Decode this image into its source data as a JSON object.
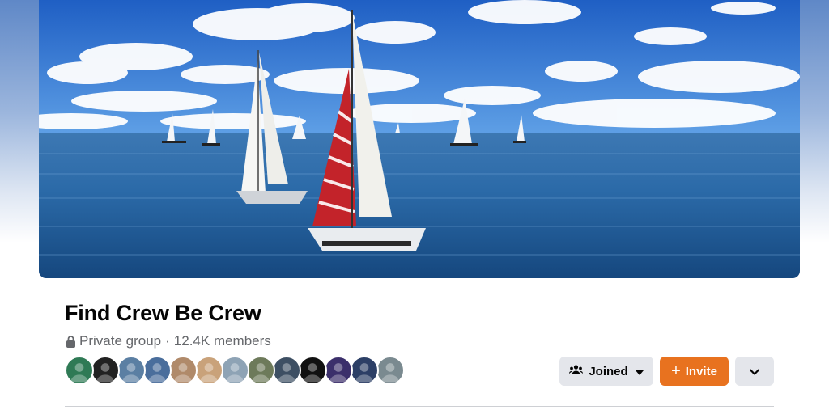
{
  "group": {
    "name": "Find Crew Be Crew",
    "privacy": "Private group",
    "separator": "·",
    "members": "12.4K members"
  },
  "cover": {
    "icon": "sailboats-cover-photo"
  },
  "member_avatars": [
    {
      "color": "#2f7a55"
    },
    {
      "color": "#222222"
    },
    {
      "color": "#5b7fa3"
    },
    {
      "color": "#4a6e9c"
    },
    {
      "color": "#b08a6a"
    },
    {
      "color": "#c9a27a"
    },
    {
      "color": "#8ea3b5"
    },
    {
      "color": "#6d7a5a"
    },
    {
      "color": "#3d4f63"
    },
    {
      "color": "#111111"
    },
    {
      "color": "#3b2f6b"
    },
    {
      "color": "#2c3f66"
    },
    {
      "color": "#7a8a90"
    }
  ],
  "actions": {
    "joined_label": "Joined",
    "invite_label": "Invite",
    "invite_prefix": "+",
    "joined_icon": "people-icon",
    "more_icon": "chevron-down-icon"
  },
  "colors": {
    "accent": "#e8721f",
    "button_gray": "#e4e6eb",
    "muted_text": "#65676b"
  }
}
